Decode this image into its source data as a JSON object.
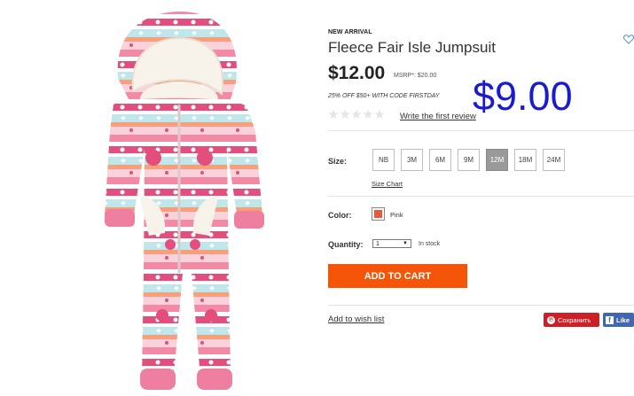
{
  "product": {
    "badge": "NEW ARRIVAL",
    "title": "Fleece Fair Isle Jumpsuit",
    "price": "$12.00",
    "msrp": "MSRP*: $20.00",
    "sale_price": "$9.00",
    "promo": "25% OFF $50+ WITH CODE FIRSTDAY",
    "rating_stars": 0,
    "review_link": "Write the first review",
    "image_icon": "fair-isle-jumpsuit-photo",
    "heart_icon": "wishlist-heart-icon"
  },
  "size": {
    "label": "Size:",
    "options": [
      "NB",
      "3M",
      "6M",
      "9M",
      "12M",
      "18M",
      "24M"
    ],
    "selected": "12M",
    "chart_link": "Size Chart"
  },
  "color": {
    "label": "Color:",
    "name": "Pink",
    "swatch_hex": "#e85a3c"
  },
  "quantity": {
    "label": "Quantity:",
    "value": "1",
    "stock": "In stock"
  },
  "actions": {
    "add_to_cart": "ADD TO CART",
    "wish_list": "Add to wish list",
    "pinterest": "Сохранить",
    "facebook": "Like"
  },
  "colors": {
    "add_to_cart_bg": "#f55508",
    "sale_price": "#1a1ad0",
    "pinterest": "#cb2027",
    "facebook": "#4267b2"
  }
}
